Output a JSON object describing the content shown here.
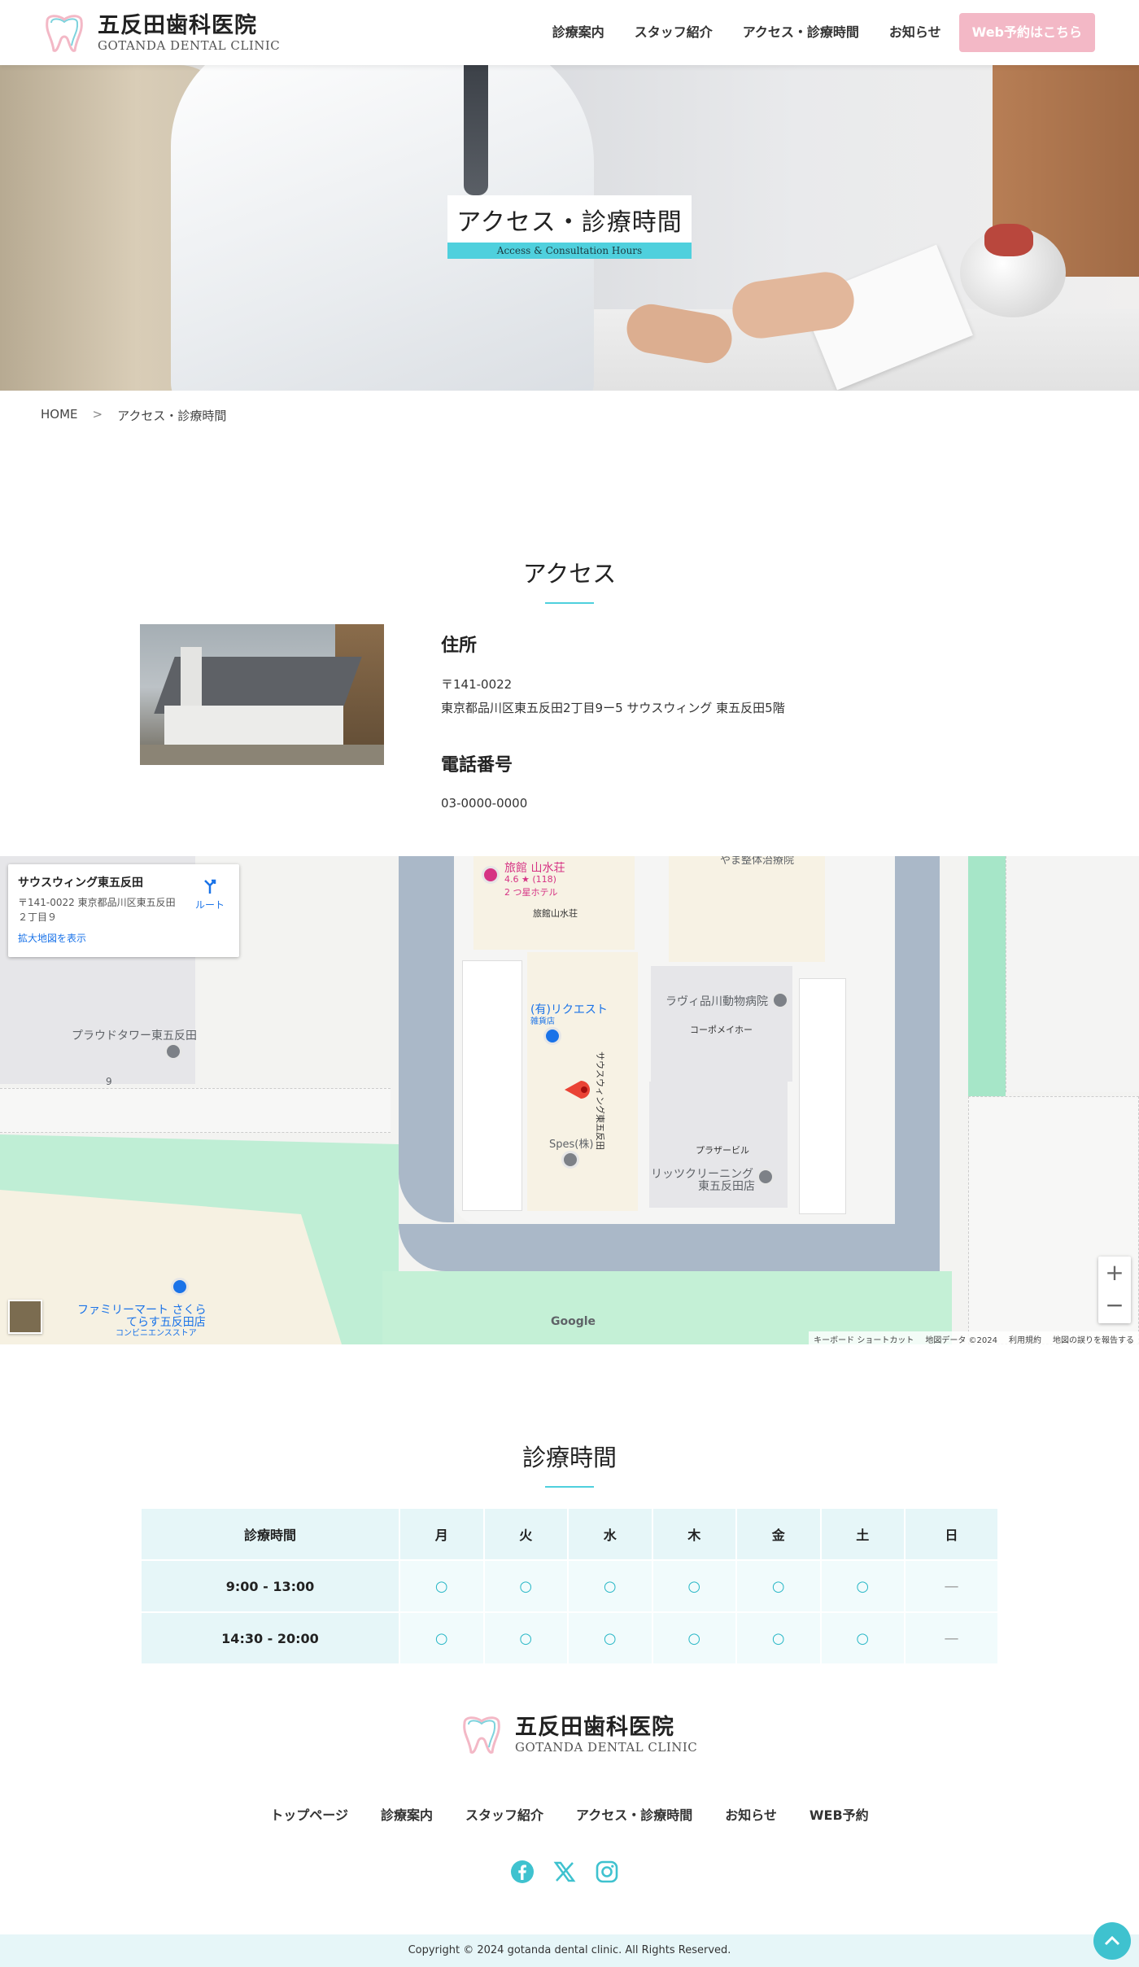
{
  "header": {
    "logo_jp": "五反田歯科医院",
    "logo_en": "GOTANDA DENTAL CLINIC",
    "nav": [
      "診療案内",
      "スタッフ紹介",
      "アクセス・診療時間",
      "お知らせ"
    ],
    "cta": "Web予約はこちら"
  },
  "hero": {
    "title": "アクセス・診療時間",
    "subtitle": "Access & Consultation Hours"
  },
  "breadcrumb": {
    "home": "HOME",
    "sep": ">",
    "current": "アクセス・診療時間"
  },
  "access": {
    "heading": "アクセス",
    "address_label": "住所",
    "postal": "〒141-0022",
    "address": "東京都品川区東五反田2丁目9ー5 サウスウィング 東五反田5階",
    "phone_label": "電話番号",
    "phone": "03-0000-0000"
  },
  "map": {
    "panel_title": "サウスウィング東五反田",
    "panel_address": "〒141-0022 東京都品川区東五反田２丁目９",
    "panel_link": "拡大地図を表示",
    "route": "ルート",
    "labels": {
      "ryokan": "旅館 山水荘",
      "ryokan_rating": "4.6 ★ (118)",
      "ryokan_type": "2 つ星ホテル",
      "ryokan_bldg": "旅館山水荘",
      "seitai": "やま整体治療院",
      "proud": "プラウドタワー東五反田",
      "nine": "9",
      "request": "(有)リクエスト",
      "request_type": "雑貨店",
      "south": "サウスウィング東五反田",
      "lavie": "ラヴィ品川動物病院",
      "cope": "コーポメイホー",
      "spes": "Spes(株)",
      "plaza": "プラザービル",
      "ritz": "リッツクリーニング",
      "ritz2": "東五反田店",
      "family": "ファミリーマート さくら",
      "family2": "てらす五反田店",
      "family3": "コンビニエンスストア",
      "google": "Google"
    },
    "footer": [
      "キーボード ショートカット",
      "地図データ ©2024",
      "利用規約",
      "地図の誤りを報告する"
    ],
    "zoom_in": "+",
    "zoom_out": "−"
  },
  "hours": {
    "heading": "診療時間",
    "header_label": "診療時間",
    "days": [
      "月",
      "火",
      "水",
      "木",
      "金",
      "土",
      "日"
    ],
    "rows": [
      {
        "time": "9:00 - 13:00",
        "marks": [
          "○",
          "○",
          "○",
          "○",
          "○",
          "○",
          "—"
        ]
      },
      {
        "time": "14:30 - 20:00",
        "marks": [
          "○",
          "○",
          "○",
          "○",
          "○",
          "○",
          "—"
        ]
      }
    ]
  },
  "footer": {
    "logo_jp": "五反田歯科医院",
    "logo_en": "GOTANDA DENTAL CLINIC",
    "nav": [
      "トップページ",
      "診療案内",
      "スタッフ紹介",
      "アクセス・診療時間",
      "お知らせ",
      "WEB予約"
    ],
    "copyright": "Copyright © 2024 gotanda dental clinic. All Rights Reserved."
  },
  "colors": {
    "accent": "#4fd0dd",
    "cta": "#f3b8c6",
    "table_bg": "#e6f6f8"
  }
}
